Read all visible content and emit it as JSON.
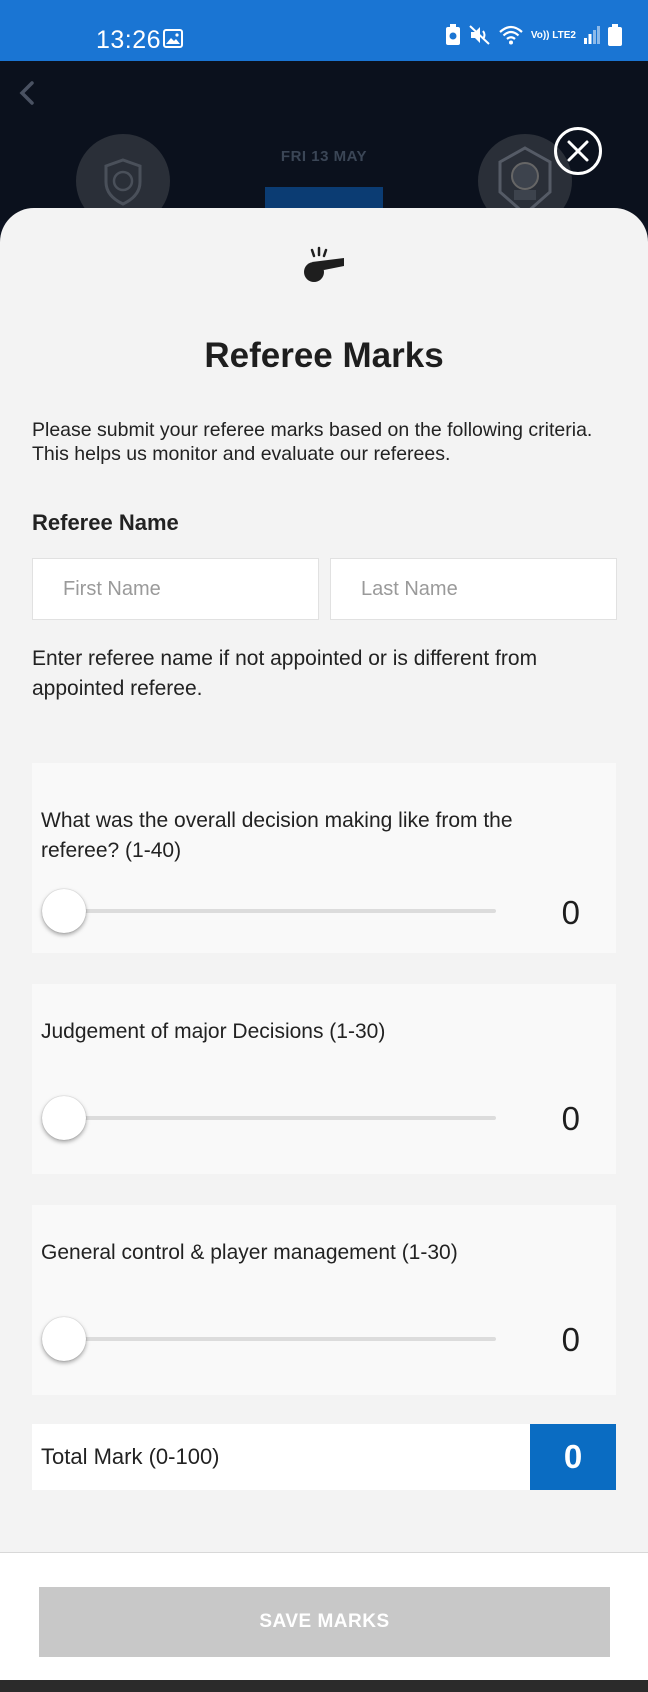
{
  "status_bar": {
    "time": "13:26",
    "network_label": "Vo)) LTE2"
  },
  "match": {
    "date": "FRI 13 MAY"
  },
  "sheet": {
    "title": "Referee Marks",
    "intro": "Please submit your referee marks based on the following criteria. This helps us monitor and evaluate our referees.",
    "referee_name_label": "Referee Name",
    "first_name_placeholder": "First Name",
    "last_name_placeholder": "Last Name",
    "name_help": "Enter referee name if not appointed or is different from appointed referee."
  },
  "criteria": [
    {
      "question": "What was the overall decision making like from the referee? (1-40)",
      "value": "0",
      "level": 0
    },
    {
      "question": "Judgement of major Decisions (1-30)",
      "value": "0",
      "level": 0
    },
    {
      "question": "General control & player management (1-30)",
      "value": "0",
      "level": 0
    }
  ],
  "total": {
    "label": "Total Mark (0-100)",
    "value": "0"
  },
  "footer": {
    "save_label": "SAVE MARKS"
  },
  "colors": {
    "status_bar": "#1a75d3",
    "accent": "#0a6cc2",
    "button_disabled": "#c8c8c8"
  },
  "icons": {
    "back": "chevron-left-icon",
    "close": "close-icon",
    "whistle": "whistle-icon"
  }
}
